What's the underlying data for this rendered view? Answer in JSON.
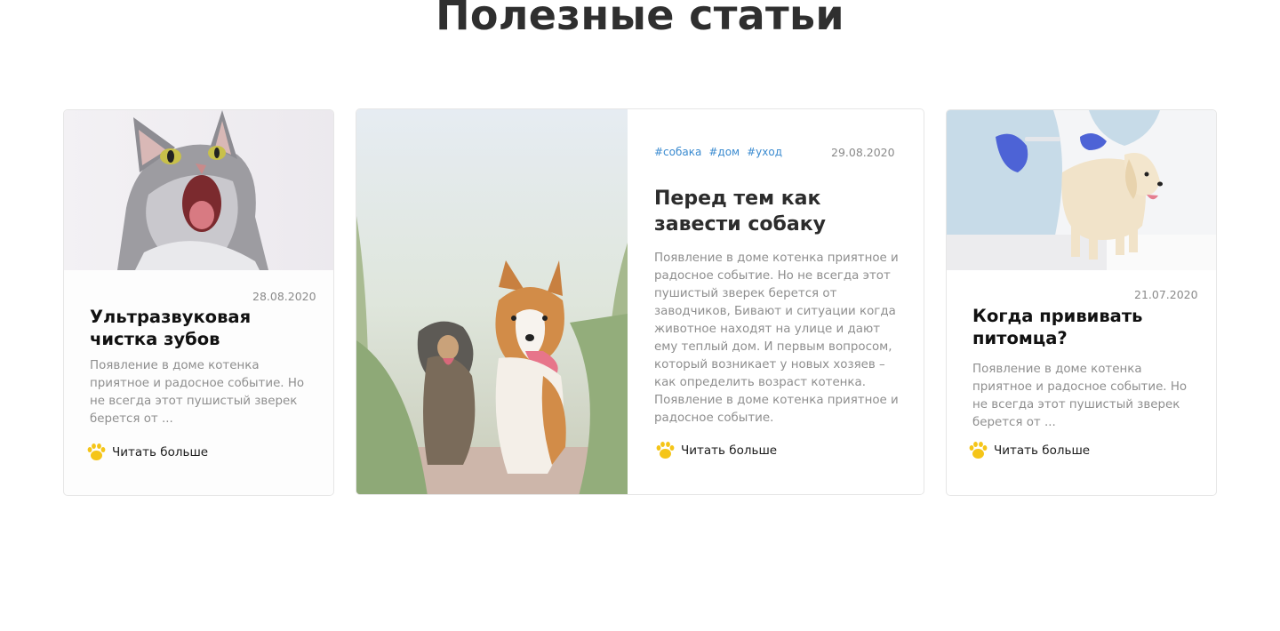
{
  "section": {
    "title": "Полезные статьи"
  },
  "articles": [
    {
      "date": "28.08.2020",
      "title": "Ультразвуковая чистка зубов",
      "excerpt": "Появление в доме котенка приятное и радосное событие. Но не всегда этот пушистый зверек берется от ...",
      "read_more": "Читать больше",
      "image_icon": "cat-photo"
    },
    {
      "tags": [
        "#собака",
        "#дом",
        "#уход"
      ],
      "date": "29.08.2020",
      "title": "Перед тем как завести собаку",
      "excerpt": "Появление в доме котенка приятное и радосное событие. Но не всегда этот пушистый зверек берется от заводчиков, Бивают и ситуации когда животное находят на улице и дают ему теплый дом. И первым вопросом, который возникает у новых хозяев – как определить возраст котенка. Появление в доме котенка приятное и радосное событие.",
      "read_more": "Читать больше",
      "image_icon": "dogs-photo"
    },
    {
      "date": "21.07.2020",
      "title": "Когда прививать питомца?",
      "excerpt": "Появление в доме котенка приятное и радосное событие. Но не всегда этот пушистый зверек берется от ...",
      "read_more": "Читать больше",
      "image_icon": "puppy-vet-photo"
    }
  ],
  "colors": {
    "tag": "#3b8bd0",
    "paw": "#f5c518",
    "title": "#2f2f2f"
  }
}
